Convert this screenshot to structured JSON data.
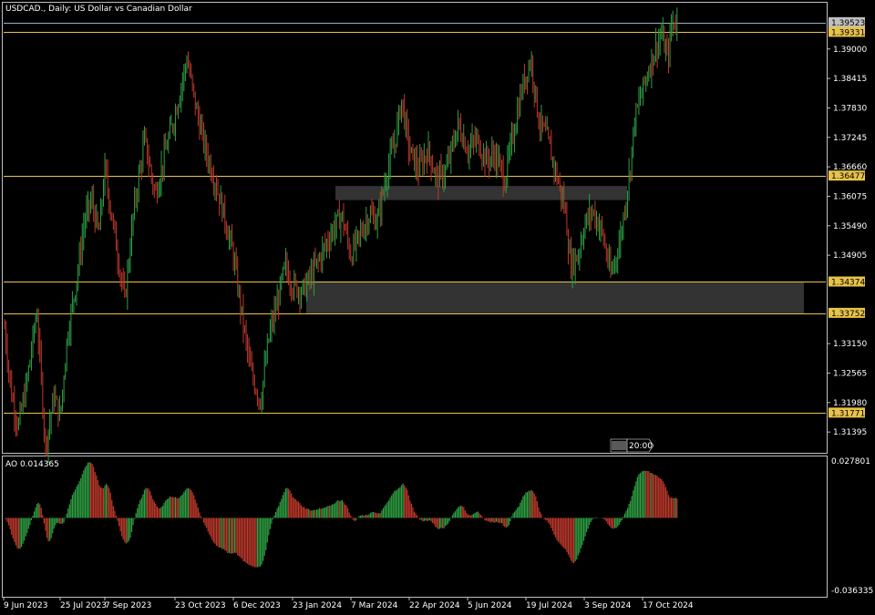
{
  "header": {
    "title": "USDCAD., Daily:  US Dollar vs Canadian Dollar"
  },
  "indicator": {
    "title": "AO 0.014365"
  },
  "colors": {
    "background": "#000000",
    "frame": "#c0c0c0",
    "bull": "#2ea043",
    "bear": "#c0392b",
    "level": "#e8c34a",
    "zone": "#333333",
    "bid_line": "#8fb3c8"
  },
  "chart_data": [
    {
      "type": "candlestick",
      "symbol": "USDCAD.",
      "timeframe": "Daily",
      "ylim": [
        1.31,
        1.399
      ],
      "y_ticks": [
        "1.39000",
        "1.38415",
        "1.37830",
        "1.37245",
        "1.36660",
        "1.36075",
        "1.35490",
        "1.34905",
        "1.33150",
        "1.32565",
        "1.31980",
        "1.31395"
      ],
      "x_labels": [
        "9 Jun 2023",
        "25 Jul 2023",
        "7 Sep 2023",
        "23 Oct 2023",
        "6 Dec 2023",
        "23 Jan 2024",
        "7 Mar 2024",
        "22 Apr 2024",
        "5 Jun 2024",
        "19 Jul 2024",
        "3 Sep 2024",
        "17 Oct 2024"
      ],
      "price_labels": [
        {
          "value": 1.39523,
          "text": "1.39523",
          "kind": "bid"
        },
        {
          "value": 1.39331,
          "text": "1.39331",
          "kind": "level"
        },
        {
          "value": 1.36477,
          "text": "1.36477",
          "kind": "level"
        },
        {
          "value": 1.34374,
          "text": "1.34374",
          "kind": "level"
        },
        {
          "value": 1.33752,
          "text": "1.33752",
          "kind": "level"
        },
        {
          "value": 1.31771,
          "text": "1.31771",
          "kind": "level"
        }
      ],
      "zones": [
        {
          "x_start": "Feb 2024",
          "x_end": "Sep 2024",
          "y_low": 1.36,
          "y_high": 1.3628
        },
        {
          "x_start": "Jan 2024",
          "x_end": "Nov 2024",
          "y_low": 1.3375,
          "y_high": 1.3437
        }
      ],
      "series_anchors": [
        {
          "date": "9 Jun 2023",
          "close": 1.3365
        },
        {
          "date": "15 Jun 2023",
          "close": 1.322
        },
        {
          "date": "21 Jun 2023",
          "close": 1.315
        },
        {
          "date": "28 Jun 2023",
          "close": 1.324
        },
        {
          "date": "6 Jul 2023",
          "close": 1.338
        },
        {
          "date": "13 Jul 2023",
          "close": 1.311
        },
        {
          "date": "20 Jul 2023",
          "close": 1.321
        },
        {
          "date": "25 Jul 2023",
          "close": 1.317
        },
        {
          "date": "1 Aug 2023",
          "close": 1.333
        },
        {
          "date": "10 Aug 2023",
          "close": 1.344
        },
        {
          "date": "18 Aug 2023",
          "close": 1.356
        },
        {
          "date": "25 Aug 2023",
          "close": 1.36
        },
        {
          "date": "1 Sep 2023",
          "close": 1.353
        },
        {
          "date": "7 Sep 2023",
          "close": 1.366
        },
        {
          "date": "14 Sep 2023",
          "close": 1.352
        },
        {
          "date": "20 Sep 2023",
          "close": 1.34
        },
        {
          "date": "26 Sep 2023",
          "close": 1.358
        },
        {
          "date": "3 Oct 2023",
          "close": 1.372
        },
        {
          "date": "10 Oct 2023",
          "close": 1.361
        },
        {
          "date": "17 Oct 2023",
          "close": 1.37
        },
        {
          "date": "23 Oct 2023",
          "close": 1.377
        },
        {
          "date": "1 Nov 2023",
          "close": 1.388
        },
        {
          "date": "8 Nov 2023",
          "close": 1.378
        },
        {
          "date": "15 Nov 2023",
          "close": 1.37
        },
        {
          "date": "22 Nov 2023",
          "close": 1.364
        },
        {
          "date": "29 Nov 2023",
          "close": 1.357
        },
        {
          "date": "6 Dec 2023",
          "close": 1.349
        },
        {
          "date": "13 Dec 2023",
          "close": 1.337
        },
        {
          "date": "20 Dec 2023",
          "close": 1.326
        },
        {
          "date": "28 Dec 2023",
          "close": 1.32
        },
        {
          "date": "4 Jan 2024",
          "close": 1.333
        },
        {
          "date": "11 Jan 2024",
          "close": 1.34
        },
        {
          "date": "17 Jan 2024",
          "close": 1.347
        },
        {
          "date": "23 Jan 2024",
          "close": 1.343
        },
        {
          "date": "31 Jan 2024",
          "close": 1.342
        },
        {
          "date": "8 Feb 2024",
          "close": 1.346
        },
        {
          "date": "15 Feb 2024",
          "close": 1.35
        },
        {
          "date": "22 Feb 2024",
          "close": 1.354
        },
        {
          "date": "29 Feb 2024",
          "close": 1.357
        },
        {
          "date": "7 Mar 2024",
          "close": 1.349
        },
        {
          "date": "14 Mar 2024",
          "close": 1.353
        },
        {
          "date": "21 Mar 2024",
          "close": 1.357
        },
        {
          "date": "28 Mar 2024",
          "close": 1.356
        },
        {
          "date": "4 Apr 2024",
          "close": 1.365
        },
        {
          "date": "11 Apr 2024",
          "close": 1.372
        },
        {
          "date": "16 Apr 2024",
          "close": 1.38
        },
        {
          "date": "22 Apr 2024",
          "close": 1.37
        },
        {
          "date": "29 Apr 2024",
          "close": 1.366
        },
        {
          "date": "6 May 2024",
          "close": 1.37
        },
        {
          "date": "13 May 2024",
          "close": 1.364
        },
        {
          "date": "20 May 2024",
          "close": 1.366
        },
        {
          "date": "29 May 2024",
          "close": 1.375
        },
        {
          "date": "5 Jun 2024",
          "close": 1.37
        },
        {
          "date": "12 Jun 2024",
          "close": 1.372
        },
        {
          "date": "19 Jun 2024",
          "close": 1.368
        },
        {
          "date": "26 Jun 2024",
          "close": 1.369
        },
        {
          "date": "3 Jul 2024",
          "close": 1.364
        },
        {
          "date": "10 Jul 2024",
          "close": 1.374
        },
        {
          "date": "16 Jul 2024",
          "close": 1.382
        },
        {
          "date": "19 Jul 2024",
          "close": 1.385
        },
        {
          "date": "23 Jul 2024",
          "close": 1.388
        },
        {
          "date": "29 Jul 2024",
          "close": 1.376
        },
        {
          "date": "5 Aug 2024",
          "close": 1.372
        },
        {
          "date": "12 Aug 2024",
          "close": 1.365
        },
        {
          "date": "19 Aug 2024",
          "close": 1.358
        },
        {
          "date": "23 Aug 2024",
          "close": 1.347
        },
        {
          "date": "29 Aug 2024",
          "close": 1.349
        },
        {
          "date": "3 Sep 2024",
          "close": 1.355
        },
        {
          "date": "9 Sep 2024",
          "close": 1.358
        },
        {
          "date": "16 Sep 2024",
          "close": 1.354
        },
        {
          "date": "23 Sep 2024",
          "close": 1.345
        },
        {
          "date": "30 Sep 2024",
          "close": 1.352
        },
        {
          "date": "7 Oct 2024",
          "close": 1.365
        },
        {
          "date": "11 Oct 2024",
          "close": 1.376
        },
        {
          "date": "17 Oct 2024",
          "close": 1.382
        },
        {
          "date": "24 Oct 2024",
          "close": 1.388
        },
        {
          "date": "31 Oct 2024",
          "close": 1.393
        },
        {
          "date": "5 Nov 2024",
          "close": 1.388
        },
        {
          "date": "8 Nov 2024",
          "close": 1.3952
        }
      ]
    },
    {
      "type": "bar",
      "name": "AO",
      "value": 0.014365,
      "ylim": [
        -0.036335,
        0.027801
      ],
      "y_ticks": [
        "0.027801",
        "-0.036335"
      ]
    }
  ],
  "scroll_marker": {
    "label": "20:00"
  }
}
